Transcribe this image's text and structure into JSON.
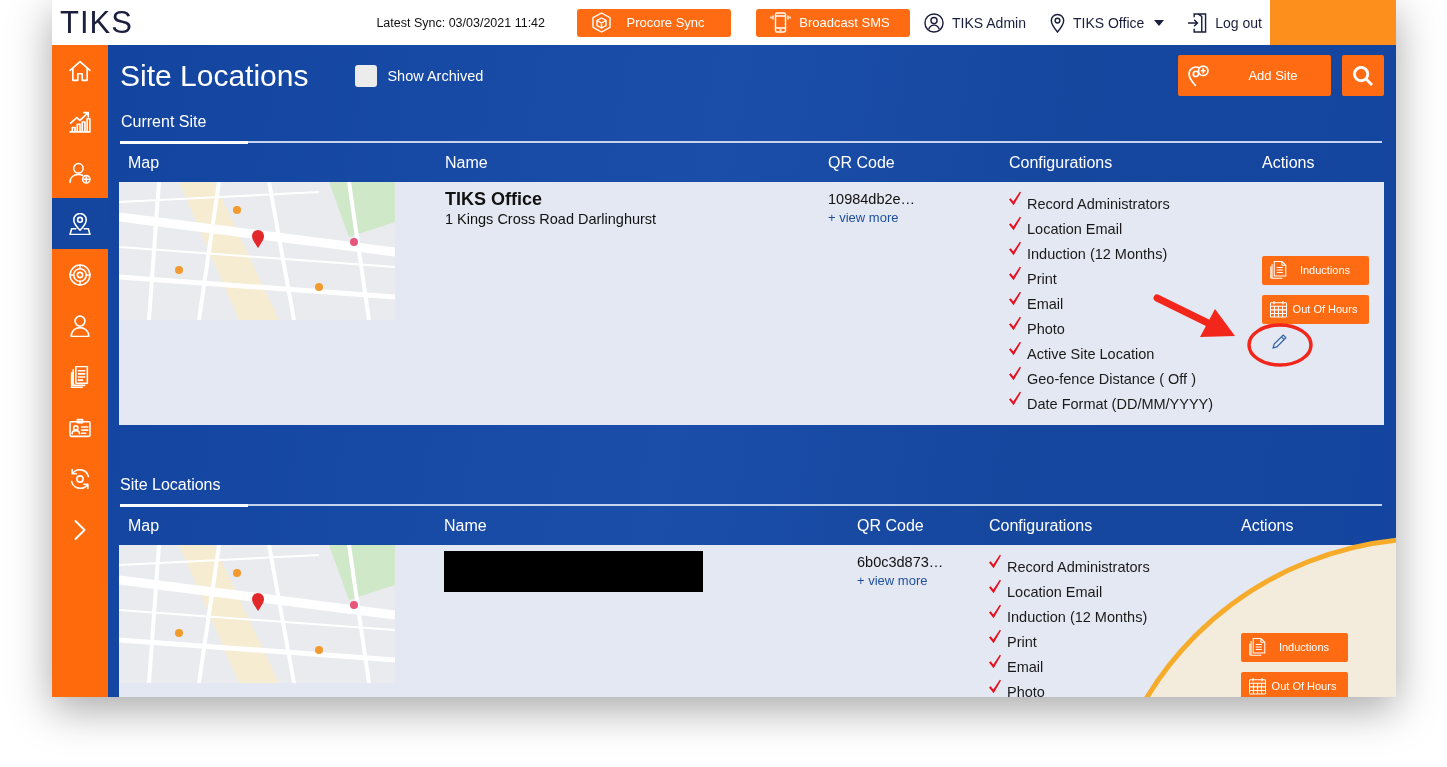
{
  "header": {
    "logo": "TIKS",
    "latest_sync": "Latest Sync: 03/03/2021 11:42",
    "buttons": [
      {
        "kind": "procore",
        "label": "Procore Sync"
      },
      {
        "kind": "sms",
        "label": "Broadcast SMS"
      }
    ],
    "user": "TIKS Admin",
    "location": "TIKS Office",
    "logout": "Log out"
  },
  "sidebar": {
    "items": [
      {
        "kind": "home",
        "selected": false
      },
      {
        "kind": "reports",
        "selected": false
      },
      {
        "kind": "add-user",
        "selected": false
      },
      {
        "kind": "locations",
        "selected": true
      },
      {
        "kind": "target",
        "selected": false
      },
      {
        "kind": "user",
        "selected": false
      },
      {
        "kind": "documents",
        "selected": false
      },
      {
        "kind": "id-card",
        "selected": false
      },
      {
        "kind": "sync",
        "selected": false
      },
      {
        "kind": "expand",
        "selected": false
      }
    ]
  },
  "page": {
    "title": "Site Locations",
    "show_archived": {
      "label": "Show Archived",
      "checked": false
    },
    "add_site": "Add Site"
  },
  "sections": [
    {
      "kind": "current",
      "title": "Current Site",
      "columns": [
        "Map",
        "Name",
        "QR Code",
        "Configurations",
        "Actions"
      ],
      "rows": [
        {
          "redacted": false,
          "name": "TIKS Office",
          "address": "1 Kings Cross Road Darlinghurst",
          "qr_code": "10984db2e…",
          "view_more": "+ view more",
          "configurations": [
            {
              "label": "Record Administrators",
              "enabled": true
            },
            {
              "label": "Location Email",
              "enabled": true
            },
            {
              "label": "Induction (12 Months)",
              "enabled": true
            },
            {
              "label": "Print",
              "enabled": true
            },
            {
              "label": "Email",
              "enabled": true
            },
            {
              "label": "Photo",
              "enabled": true
            },
            {
              "label": "Active Site Location",
              "enabled": true
            },
            {
              "label": "Geo-fence Distance ( Off )",
              "enabled": true
            },
            {
              "label": "Date Format (DD/MM/YYYY)",
              "enabled": true
            }
          ],
          "actions": [
            {
              "kind": "inductions",
              "label": "Inductions"
            },
            {
              "kind": "out-of-hours",
              "label": "Out Of Hours"
            }
          ],
          "edit": {
            "highlighted": true
          }
        }
      ]
    },
    {
      "kind": "list",
      "title": "Site Locations",
      "columns": [
        "Map",
        "Name",
        "QR Code",
        "Configurations",
        "Actions"
      ],
      "rows": [
        {
          "redacted": true,
          "qr_code": "6b0c3d873…",
          "view_more": "+ view more",
          "configurations": [
            {
              "label": "Record Administrators",
              "enabled": true
            },
            {
              "label": "Location Email",
              "enabled": true
            },
            {
              "label": "Induction (12 Months)",
              "enabled": true
            },
            {
              "label": "Print",
              "enabled": true
            },
            {
              "label": "Email",
              "enabled": true
            },
            {
              "label": "Photo",
              "enabled": true
            }
          ],
          "actions": [
            {
              "kind": "inductions",
              "label": "Inductions"
            },
            {
              "kind": "out-of-hours",
              "label": "Out Of Hours"
            }
          ]
        }
      ]
    }
  ]
}
